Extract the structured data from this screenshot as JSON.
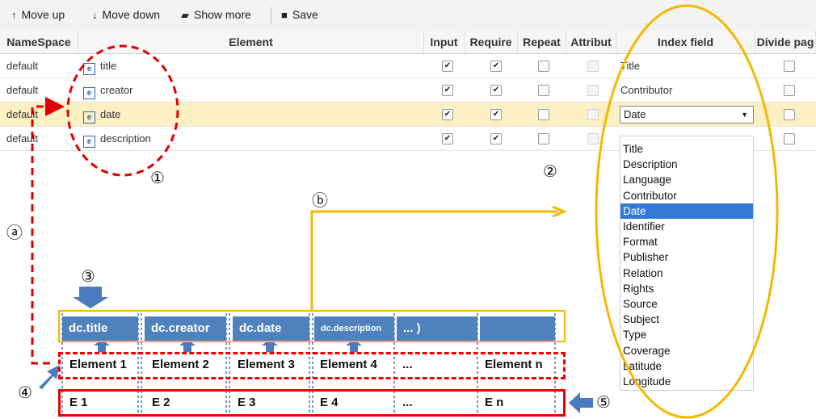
{
  "toolbar": {
    "move_up": "Move up",
    "move_down": "Move down",
    "show_more": "Show more",
    "save": "Save"
  },
  "table": {
    "headers": [
      "NameSpace",
      "Element",
      "Input",
      "Require",
      "Repeat",
      "Attribut",
      "Index field",
      "Divide pag"
    ],
    "rows": [
      {
        "namespace": "default",
        "element": "title",
        "input": true,
        "required": true,
        "repeat": false,
        "attribute": false,
        "index_field": "Title",
        "divide": false
      },
      {
        "namespace": "default",
        "element": "creator",
        "input": true,
        "required": true,
        "repeat": false,
        "attribute": false,
        "index_field": "Contributor",
        "divide": false
      },
      {
        "namespace": "default",
        "element": "date",
        "input": true,
        "required": true,
        "repeat": false,
        "attribute": false,
        "index_field": "Date",
        "divide": false,
        "selected": true
      },
      {
        "namespace": "default",
        "element": "description",
        "input": true,
        "required": true,
        "repeat": false,
        "attribute": false,
        "index_field": "",
        "divide": false
      }
    ],
    "element_icon": "e"
  },
  "dropdown": {
    "selected": "Date",
    "options": [
      "Title",
      "Description",
      "Language",
      "Contributor",
      "Date",
      "Identifier",
      "Format",
      "Publisher",
      "Relation",
      "Rights",
      "Source",
      "Subject",
      "Type",
      "Coverage",
      "Latitude",
      "Longitude"
    ],
    "highlighted": "Date"
  },
  "markers": {
    "m1": "①",
    "m2": "②",
    "m3": "③",
    "m4": "④",
    "m5": "⑤",
    "a": "ⓐ",
    "b": "ⓑ"
  },
  "schema_row": [
    "dc.title",
    "dc.creator",
    "dc.date",
    "dc.description",
    "...   )",
    ""
  ],
  "element_row": [
    "Element 1",
    "Element 2",
    "Element 3",
    "Element 4",
    "...",
    "Element n"
  ],
  "e_row": [
    "E 1",
    "E 2",
    "E 3",
    "E 4",
    "...",
    "E n"
  ],
  "colors": {
    "accent_red": "#e00000",
    "accent_yellow": "#f5b800",
    "schema_blue": "#4f81bd",
    "arrow_blue": "#4a7bc0",
    "selected_row": "#fdf0c4",
    "highlight": "#3478d6"
  }
}
